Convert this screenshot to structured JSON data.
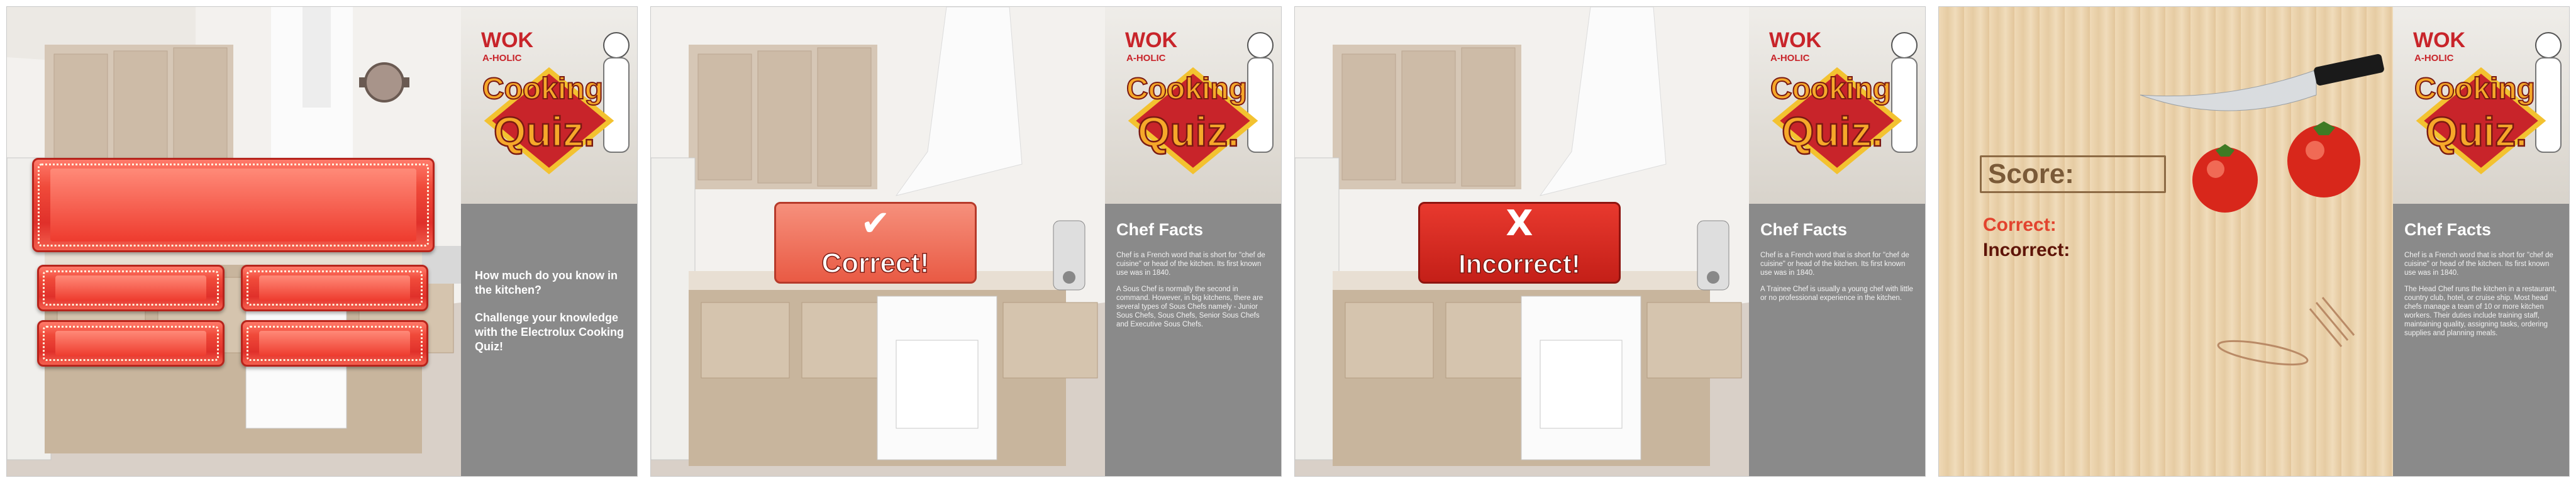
{
  "logo": {
    "brand": "WOK",
    "brand_sub": "A-HOLIC",
    "title_line1": "Cooking",
    "title_line2": "Quiz."
  },
  "screens": [
    {
      "name": "intro",
      "intro_line1": "How much do you know in the kitchen?",
      "intro_line2": "Challenge your knowledge with the Electrolux Cooking Quiz!"
    },
    {
      "name": "correct",
      "result_label": "Correct!",
      "result_glyph": "✔",
      "facts_title": "Chef Facts",
      "facts_p1": "Chef is a French word that is short for \"chef de cuisine\" or head of the kitchen. Its first known use was in 1840.",
      "facts_p2": "A Sous Chef is normally the second in command. However, in big kitchens, there are several types of Sous Chefs namely - Junior Sous Chefs, Sous Chefs, Senior Sous Chefs and Executive Sous Chefs."
    },
    {
      "name": "incorrect",
      "result_label": "Incorrect!",
      "result_glyph": "X",
      "facts_title": "Chef Facts",
      "facts_p1": "Chef is a French word that is short for \"chef de cuisine\" or head of the kitchen. Its first known use was in 1840.",
      "facts_p2": "A Trainee Chef is usually a young chef with little or no professional experience in the kitchen."
    },
    {
      "name": "score",
      "score_label": "Score:",
      "correct_label": "Correct:",
      "incorrect_label": "Incorrect:",
      "facts_title": "Chef Facts",
      "facts_p1": "Chef is a French word that is short for \"chef de cuisine\" or head of the kitchen. Its first known use was in 1840.",
      "facts_p2": "The Head Chef runs the kitchen in a restaurant, country club, hotel, or cruise ship. Most head chefs manage a team of 10 or more kitchen workers. Their duties include training staff, maintaining quality, assigning tasks, ordering supplies and planning meals."
    }
  ],
  "colors": {
    "marquee_red": "#e0302a",
    "correct_box": "#ee6a55",
    "incorrect_box": "#d62a22",
    "sidebar_grey": "#8a8a8a",
    "wood": "#e9cfa8"
  }
}
